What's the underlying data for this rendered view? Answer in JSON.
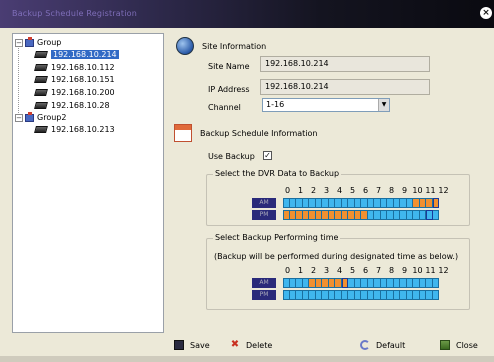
{
  "window": {
    "title": "Backup Schedule Registration"
  },
  "tree": {
    "groups": [
      {
        "label": "Group",
        "devices": [
          "192.168.10.214",
          "192.168.10.112",
          "192.168.10.151",
          "192.168.10.200",
          "192.168.10.28"
        ]
      },
      {
        "label": "Group2",
        "devices": [
          "192.168.10.213"
        ]
      }
    ],
    "selected": "192.168.10.214"
  },
  "site_info": {
    "header": "Site Information",
    "site_name_label": "Site Name",
    "site_name": "192.168.10.214",
    "ip_label": "IP Address",
    "ip": "192.168.10.214",
    "channel_label": "Channel",
    "channel": "1-16"
  },
  "backup": {
    "header": "Backup Schedule Information",
    "use_backup_label": "Use Backup",
    "use_backup": true,
    "dvr_box_title": "Select the DVR Data to Backup",
    "perform_box_title": "Select Backup Performing time",
    "perform_note": "(Backup will be performed during designated time as below.)",
    "hours": [
      "0",
      "1",
      "2",
      "3",
      "4",
      "5",
      "6",
      "7",
      "8",
      "9",
      "10",
      "11",
      "12"
    ],
    "am_label": "AM",
    "pm_label": "PM",
    "dvr_am": [
      0,
      0,
      0,
      0,
      0,
      0,
      0,
      0,
      0,
      0,
      0,
      0,
      0,
      0,
      0,
      0,
      0,
      0,
      0,
      0,
      0,
      0,
      0,
      0,
      0,
      0,
      0,
      0,
      0,
      0,
      0,
      0,
      0,
      0,
      0,
      0,
      0,
      0,
      0,
      0,
      0,
      0,
      0,
      0,
      0,
      0,
      0,
      0,
      0,
      0,
      0,
      0,
      0,
      0,
      0,
      0,
      0,
      0,
      0,
      0,
      0,
      0,
      0,
      0,
      0,
      0,
      0,
      0,
      0,
      0,
      0,
      0,
      0,
      0,
      0,
      0,
      0,
      0,
      0,
      0,
      0,
      0,
      0,
      0,
      0,
      0,
      0,
      0,
      0,
      0,
      0,
      0,
      0,
      0,
      0,
      0,
      0,
      0,
      0,
      0,
      0,
      0,
      0,
      0,
      0,
      0,
      0,
      0,
      0,
      0,
      0,
      0,
      0,
      0,
      0,
      0,
      0,
      1,
      1,
      1,
      1,
      1,
      1,
      1,
      1,
      1,
      1,
      1,
      1,
      1,
      1,
      1,
      1,
      1,
      1,
      1,
      1,
      1,
      1,
      1,
      1,
      1,
      1
    ],
    "dvr_pm": [
      1,
      1,
      1,
      1,
      1,
      1,
      1,
      1,
      1,
      1,
      1,
      1,
      1,
      1,
      1,
      1,
      1,
      1,
      1,
      1,
      1,
      1,
      1,
      1,
      1,
      1,
      1,
      1,
      1,
      1,
      1,
      1,
      1,
      1,
      1,
      1,
      1,
      1,
      1,
      1,
      1,
      1,
      1,
      1,
      1,
      1,
      1,
      1,
      1,
      1,
      1,
      1,
      1,
      1,
      1,
      1,
      1,
      1,
      1,
      1,
      1,
      1,
      1,
      1,
      1,
      1,
      1,
      1,
      1,
      1,
      1,
      1,
      1,
      1,
      1,
      1,
      1,
      1,
      1,
      1,
      1,
      1,
      1,
      1,
      1,
      1,
      1,
      1,
      1,
      0,
      0,
      0,
      0,
      0,
      0,
      0,
      0,
      0,
      0,
      0,
      0,
      0,
      0,
      0,
      0,
      0,
      0,
      0,
      0,
      0,
      0,
      0,
      0,
      0,
      0,
      0,
      0,
      0,
      0,
      0,
      0,
      0,
      0,
      0,
      0,
      0,
      0,
      0,
      0,
      0,
      0,
      0,
      0,
      0,
      0,
      0,
      0,
      0,
      0,
      0,
      0,
      0,
      0,
      0,
      0,
      0,
      0,
      0,
      0,
      0,
      0,
      0,
      0,
      0,
      0,
      0,
      0,
      0,
      0,
      0,
      0,
      0,
      0,
      0,
      0,
      0
    ],
    "perform_am": [
      0,
      0,
      0,
      0,
      0,
      0,
      0,
      0,
      0,
      0,
      0,
      0,
      0,
      0,
      0,
      0,
      0,
      0,
      0,
      0,
      0,
      0,
      0,
      0,
      1,
      1,
      1,
      1,
      1,
      1,
      1,
      1,
      1,
      1,
      1,
      1,
      1,
      1,
      1,
      1,
      1,
      1,
      1,
      1,
      1,
      1,
      1,
      1,
      1,
      1,
      1,
      1,
      1,
      1,
      1,
      1,
      1,
      1,
      1,
      1,
      0,
      0,
      0,
      0,
      0,
      0,
      0,
      0,
      0,
      0,
      0,
      0,
      0,
      0,
      0,
      0,
      0,
      0,
      0,
      0,
      0,
      0,
      0,
      0,
      0,
      0,
      0,
      0,
      0,
      0,
      0,
      0,
      0,
      0,
      0,
      0,
      0,
      0,
      0,
      0,
      0,
      0,
      0,
      0,
      0,
      0,
      0,
      0,
      0,
      0,
      0,
      0,
      0,
      0,
      0,
      0,
      0,
      0,
      0,
      0,
      0,
      0,
      0,
      0,
      0,
      0,
      0,
      0,
      0,
      0,
      0,
      0,
      0,
      0,
      0,
      0,
      0,
      0,
      0,
      0,
      0,
      0,
      0,
      0,
      0,
      0,
      0
    ],
    "perform_pm": []
  },
  "buttons": {
    "save": "Save",
    "delete": "Delete",
    "default": "Default",
    "close": "Close"
  },
  "colors": {
    "selected_cell": "#f09030",
    "unselected_cell": "#3fb6ee",
    "grid_tag": "#2a2a7a"
  }
}
